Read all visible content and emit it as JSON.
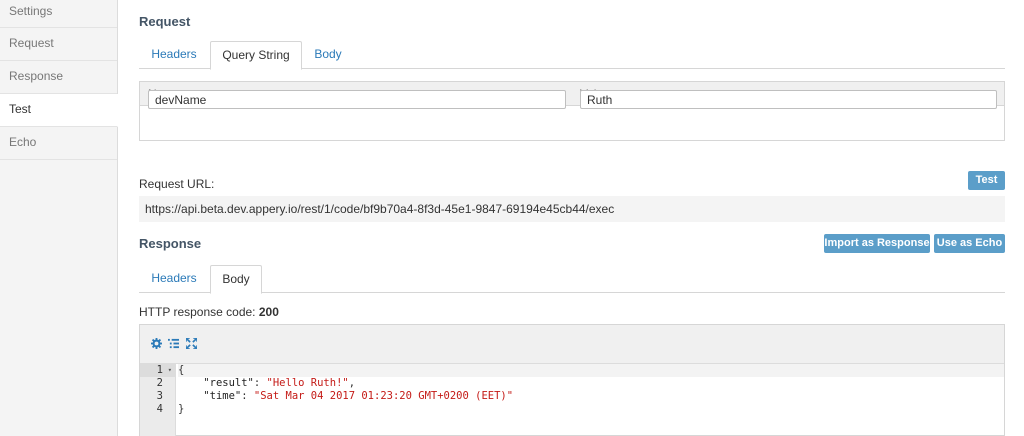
{
  "sidebar": {
    "items": [
      {
        "label": "Settings"
      },
      {
        "label": "Request"
      },
      {
        "label": "Response"
      },
      {
        "label": "Test"
      },
      {
        "label": "Echo"
      }
    ]
  },
  "request": {
    "title": "Request",
    "tabs": [
      {
        "label": "Headers"
      },
      {
        "label": "Query String"
      },
      {
        "label": "Body"
      }
    ],
    "columns": {
      "name": "Name",
      "value": "Value"
    },
    "param": {
      "name": "devName",
      "value": "Ruth"
    },
    "url_label": "Request URL:",
    "url": "https://api.beta.dev.appery.io/rest/1/code/bf9b70a4-8f3d-45e1-9847-69194e45cb44/exec",
    "test_button": "Test"
  },
  "response": {
    "title": "Response",
    "import_button": "Import as Response",
    "echo_button": "Use as Echo",
    "tabs": [
      {
        "label": "Headers"
      },
      {
        "label": "Body"
      }
    ],
    "code_label": "HTTP response code:",
    "code_value": "200",
    "editor": {
      "line_numbers": [
        "1",
        "2",
        "3",
        "4"
      ],
      "open_brace": "{",
      "close_brace": "}",
      "key_result": "\"result\"",
      "val_result": "\"Hello Ruth!\"",
      "key_time": "\"time\"",
      "val_time": "\"Sat Mar 04 2017 01:23:20 GMT+0200 (EET)\""
    }
  },
  "colors": {
    "accent": "#2b7ab8",
    "button": "#5b9ec9",
    "string": "#c41a16"
  },
  "icons": [
    "gear-icon",
    "tree-view-icon",
    "fullscreen-icon",
    "fold-arrow-icon"
  ]
}
